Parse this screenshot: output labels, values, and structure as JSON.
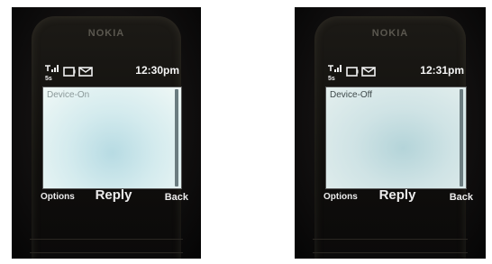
{
  "phones": [
    {
      "brand": "NOKIA",
      "clock": "12:30pm",
      "message_text": "Device-On",
      "softkeys": {
        "left": "Options",
        "center": "Reply",
        "right": "Back"
      }
    },
    {
      "brand": "NOKIA",
      "clock": "12:31pm",
      "message_text": "Device-Off",
      "softkeys": {
        "left": "Options",
        "center": "Reply",
        "right": "Back"
      }
    }
  ],
  "icons": [
    "signal-strength-icon",
    "battery-icon",
    "envelope-icon"
  ],
  "colors": {
    "screen_tint": "#cfe8ec",
    "phone_body": "#121010"
  }
}
